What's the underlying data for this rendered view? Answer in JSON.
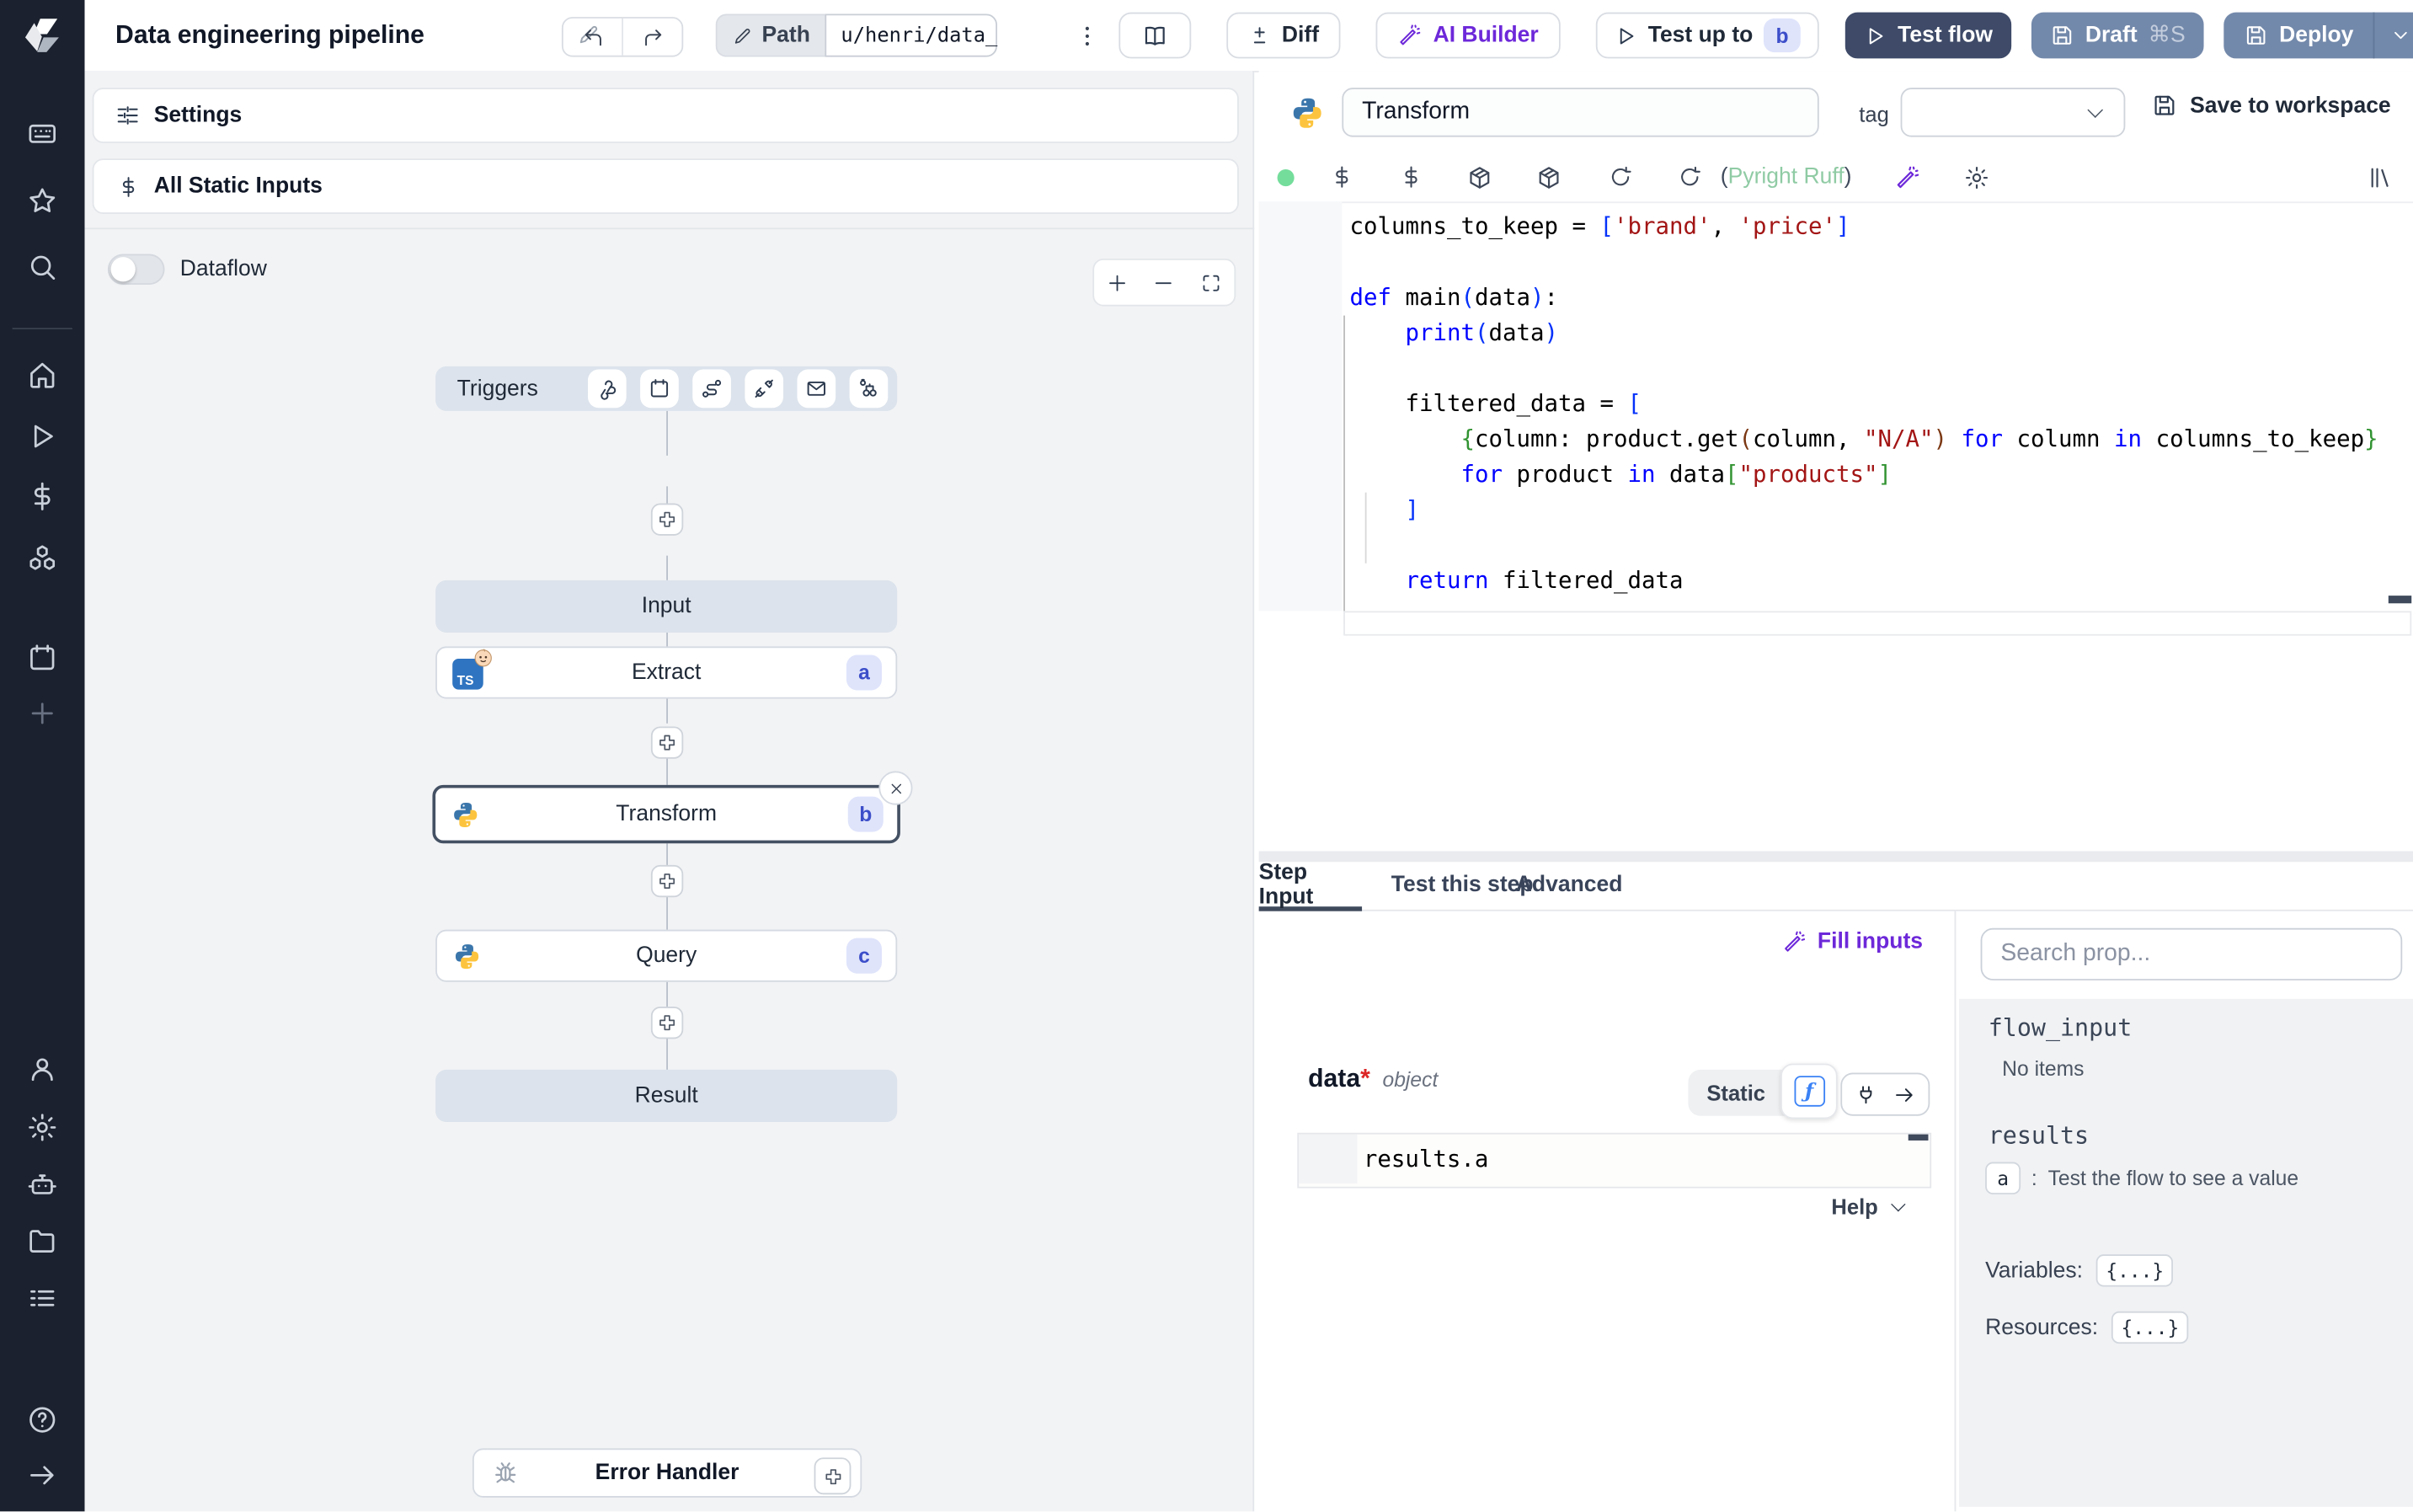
{
  "app": {
    "title": "Data engineering pipeline"
  },
  "topbar": {
    "path_label": "Path",
    "path_value": "u/henri/data_",
    "diff_label": "Diff",
    "ai_builder_label": "AI Builder",
    "test_up_to_label": "Test up to",
    "test_up_to_badge": "b",
    "test_flow_label": "Test flow",
    "draft_label": "Draft",
    "draft_shortcut": "⌘S",
    "deploy_label": "Deploy"
  },
  "sidebar": {
    "icons": [
      "keyboard",
      "star",
      "search",
      "home",
      "play",
      "dollar",
      "boxes",
      "calendar",
      "plus",
      "user",
      "settings",
      "robot",
      "folder",
      "list",
      "help",
      "arrow-right"
    ]
  },
  "flow": {
    "settings_label": "Settings",
    "static_inputs_label": "All Static Inputs",
    "dataflow_label": "Dataflow",
    "triggers_label": "Triggers",
    "trigger_icons": [
      "webhook",
      "schedule",
      "route",
      "unplug",
      "email",
      "poll"
    ],
    "nodes": {
      "input_label": "Input",
      "extract_label": "Extract",
      "extract_badge": "a",
      "extract_lang": "TS",
      "transform_label": "Transform",
      "transform_badge": "b",
      "query_label": "Query",
      "query_badge": "c",
      "result_label": "Result",
      "error_handler_label": "Error Handler"
    }
  },
  "editor": {
    "step_name": "Transform",
    "tag_label": "tag",
    "save_label": "Save to workspace",
    "lint_open": "(",
    "lint_text": "Pyright Ruff",
    "lint_close": ")",
    "code": [
      [
        [
          "d",
          "columns_to_keep = "
        ],
        [
          "b1",
          "["
        ],
        [
          "s",
          "'brand'"
        ],
        [
          "d",
          ", "
        ],
        [
          "s",
          "'price'"
        ],
        [
          "b1",
          "]"
        ]
      ],
      [],
      [
        [
          "k",
          "def"
        ],
        [
          "d",
          " main"
        ],
        [
          "b1",
          "("
        ],
        [
          "d",
          "data"
        ],
        [
          "b1",
          ")"
        ],
        [
          "d",
          ":"
        ]
      ],
      [
        [
          "d",
          "    "
        ],
        [
          "k",
          "print"
        ],
        [
          "b1",
          "("
        ],
        [
          "d",
          "data"
        ],
        [
          "b1",
          ")"
        ]
      ],
      [],
      [
        [
          "d",
          "    filtered_data = "
        ],
        [
          "b1",
          "["
        ]
      ],
      [
        [
          "d",
          "        "
        ],
        [
          "b2",
          "{"
        ],
        [
          "d",
          "column: product.get"
        ],
        [
          "b3",
          "("
        ],
        [
          "d",
          "column, "
        ],
        [
          "s",
          "\"N/A\""
        ],
        [
          "b3",
          ")"
        ],
        [
          "d",
          " "
        ],
        [
          "k",
          "for"
        ],
        [
          "d",
          " column "
        ],
        [
          "k",
          "in"
        ],
        [
          "d",
          " columns_to_keep"
        ],
        [
          "b2",
          "}"
        ]
      ],
      [
        [
          "d",
          "        "
        ],
        [
          "k",
          "for"
        ],
        [
          "d",
          " product "
        ],
        [
          "k",
          "in"
        ],
        [
          "d",
          " data"
        ],
        [
          "b2",
          "["
        ],
        [
          "s",
          "\"products\""
        ],
        [
          "b2",
          "]"
        ]
      ],
      [
        [
          "d",
          "    "
        ],
        [
          "b1",
          "]"
        ]
      ],
      [],
      [
        [
          "d",
          "    "
        ],
        [
          "k",
          "return"
        ],
        [
          "d",
          " filtered_data"
        ]
      ]
    ]
  },
  "tabs": {
    "step_input": "Step Input",
    "test_this_step": "Test this step",
    "advanced": "Advanced",
    "fill_inputs": "Fill inputs"
  },
  "step_input": {
    "arg_name": "data",
    "required_mark": "*",
    "arg_type": "object",
    "static_label": "Static",
    "fn_glyph": "ƒ",
    "expression": "results.a",
    "help_label": "Help"
  },
  "props": {
    "search_placeholder": "Search prop...",
    "flow_input_label": "flow_input",
    "no_items": "No items",
    "results_label": "results",
    "result_key": "a",
    "result_sep": ":",
    "result_hint": "Test the flow to see a value",
    "variables_label": "Variables:",
    "variables_value": "{...}",
    "resources_label": "Resources:",
    "resources_value": "{...}"
  },
  "colors": {
    "accent_purple": "#6d28d9",
    "navy_button": "#3e4a68",
    "slate_button": "#7389ab",
    "badge_bg": "#dfe4fb",
    "badge_text": "#3c4ec9",
    "ok_green": "#74dd9b",
    "lint_green": "#8fcba4",
    "selected_border": "#445063"
  }
}
